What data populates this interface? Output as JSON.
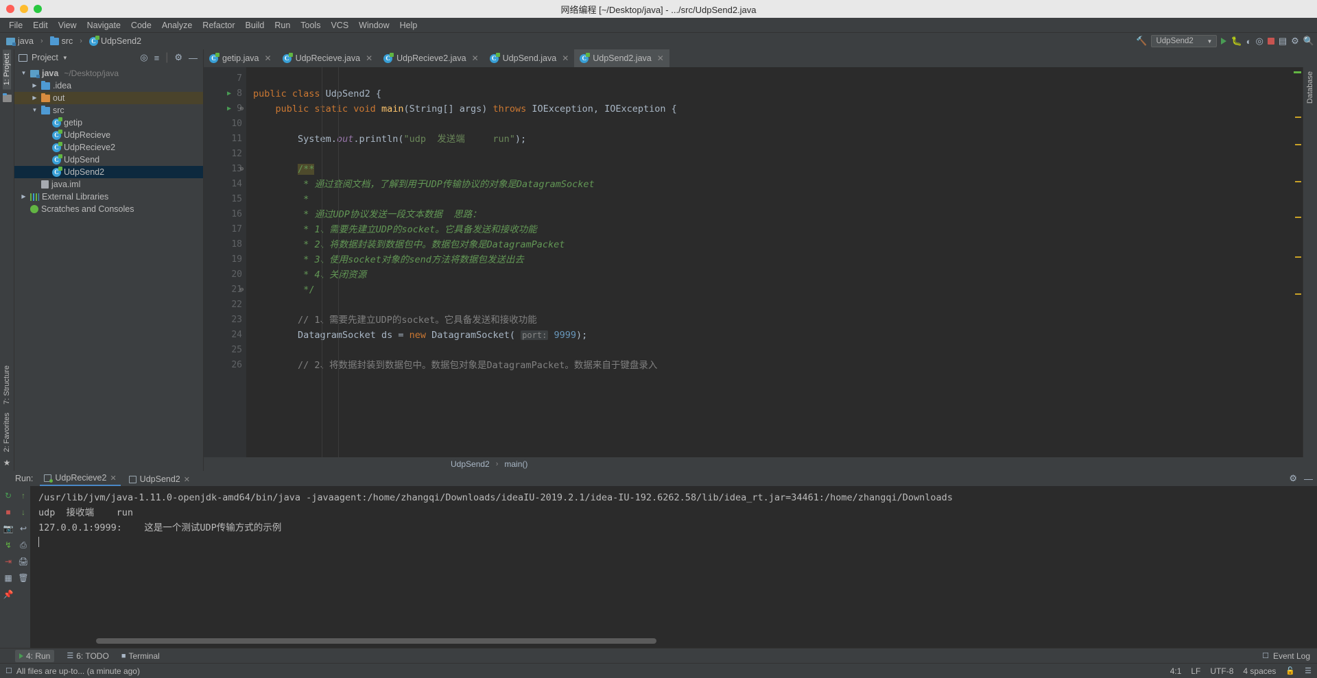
{
  "window": {
    "title": "网络编程 [~/Desktop/java] - .../src/UdpSend2.java",
    "traffic": [
      "close",
      "minimize",
      "maximize"
    ]
  },
  "menubar": {
    "items": [
      "File",
      "Edit",
      "View",
      "Navigate",
      "Code",
      "Analyze",
      "Refactor",
      "Build",
      "Run",
      "Tools",
      "VCS",
      "Window",
      "Help"
    ]
  },
  "navbar": {
    "breadcrumb": [
      "java",
      "src",
      "UdpSend2"
    ],
    "separator": "›",
    "run_configuration": "UdpSend2"
  },
  "left_strip": {
    "project_label": "1: Project",
    "structure_label": "7: Structure",
    "favorites_label": "2: Favorites"
  },
  "project_panel": {
    "title": "Project",
    "tree": [
      {
        "indent": 0,
        "arrow": "▼",
        "icon": "module-icon",
        "label": "java",
        "path": "~/Desktop/java",
        "bold": true,
        "state": ""
      },
      {
        "indent": 1,
        "arrow": "▶",
        "icon": "folder-icon",
        "label": ".idea",
        "path": "",
        "bold": false,
        "state": ""
      },
      {
        "indent": 1,
        "arrow": "▶",
        "icon": "folder-orange-icon",
        "label": "out",
        "path": "",
        "bold": false,
        "state": "out"
      },
      {
        "indent": 1,
        "arrow": "▼",
        "icon": "folder-icon",
        "label": "src",
        "path": "",
        "bold": false,
        "state": ""
      },
      {
        "indent": 2,
        "arrow": "",
        "icon": "class-icon",
        "label": "getip",
        "path": "",
        "bold": false,
        "state": ""
      },
      {
        "indent": 2,
        "arrow": "",
        "icon": "class-icon",
        "label": "UdpRecieve",
        "path": "",
        "bold": false,
        "state": ""
      },
      {
        "indent": 2,
        "arrow": "",
        "icon": "class-icon",
        "label": "UdpRecieve2",
        "path": "",
        "bold": false,
        "state": ""
      },
      {
        "indent": 2,
        "arrow": "",
        "icon": "class-icon",
        "label": "UdpSend",
        "path": "",
        "bold": false,
        "state": ""
      },
      {
        "indent": 2,
        "arrow": "",
        "icon": "class-icon",
        "label": "UdpSend2",
        "path": "",
        "bold": false,
        "state": "selected"
      },
      {
        "indent": 1,
        "arrow": "",
        "icon": "iml-icon",
        "label": "java.iml",
        "path": "",
        "bold": false,
        "state": ""
      },
      {
        "indent": 0,
        "arrow": "▶",
        "icon": "libraries-icon",
        "label": "External Libraries",
        "path": "",
        "bold": false,
        "state": ""
      },
      {
        "indent": 0,
        "arrow": "",
        "icon": "scratches-icon",
        "label": "Scratches and Consoles",
        "path": "",
        "bold": false,
        "state": ""
      }
    ]
  },
  "editor": {
    "tabs": [
      {
        "label": "getip.java",
        "active": false
      },
      {
        "label": "UdpRecieve.java",
        "active": false
      },
      {
        "label": "UdpRecieve2.java",
        "active": false
      },
      {
        "label": "UdpSend.java",
        "active": false
      },
      {
        "label": "UdpSend2.java",
        "active": true
      }
    ],
    "first_line": 7,
    "lines": [
      {
        "n": 7,
        "run": false,
        "fold": "",
        "html": ""
      },
      {
        "n": 8,
        "run": true,
        "fold": "",
        "html": "<span class=\"k\">public class </span><span class=\"id\">UdpSend2 {</span>"
      },
      {
        "n": 9,
        "run": true,
        "fold": "⊖",
        "html": "    <span class=\"k\">public static void </span><span class=\"fn\">main</span><span class=\"id\">(String[] args) </span><span class=\"k\">throws </span><span class=\"id\">IOException, IOException {</span>"
      },
      {
        "n": 10,
        "run": false,
        "fold": "",
        "html": ""
      },
      {
        "n": 11,
        "run": false,
        "fold": "",
        "html": "        <span class=\"id\">System.</span><span class=\"fld\">out</span><span class=\"id\">.println(</span><span class=\"st\">\"udp  发送端     run\"</span><span class=\"id\">);</span>"
      },
      {
        "n": 12,
        "run": false,
        "fold": "",
        "html": ""
      },
      {
        "n": 13,
        "run": false,
        "fold": "⊖",
        "html": "        <span class=\"jdm hl\">/**</span>"
      },
      {
        "n": 14,
        "run": false,
        "fold": "",
        "html": "         <span class=\"jdm\">*</span> <span class=\"jd\">通过查阅文档，了解到用于UDP传输协议的对象是DatagramSocket</span>"
      },
      {
        "n": 15,
        "run": false,
        "fold": "",
        "html": "         <span class=\"jdm\">*</span>"
      },
      {
        "n": 16,
        "run": false,
        "fold": "",
        "html": "         <span class=\"jdm\">*</span> <span class=\"jd\">通过UDP协议发送一段文本数据  思路：</span>"
      },
      {
        "n": 17,
        "run": false,
        "fold": "",
        "html": "         <span class=\"jdm\">*</span> <span class=\"jd\">1、需要先建立UDP的socket。它具备发送和接收功能</span>"
      },
      {
        "n": 18,
        "run": false,
        "fold": "",
        "html": "         <span class=\"jdm\">*</span> <span class=\"jd\">2、将数据封装到数据包中。数据包对象是DatagramPacket</span>"
      },
      {
        "n": 19,
        "run": false,
        "fold": "",
        "html": "         <span class=\"jdm\">*</span> <span class=\"jd\">3、使用socket对象的send方法将数据包发送出去</span>"
      },
      {
        "n": 20,
        "run": false,
        "fold": "",
        "html": "         <span class=\"jdm\">*</span> <span class=\"jd\">4、关闭资源</span>"
      },
      {
        "n": 21,
        "run": false,
        "fold": "⊖",
        "html": "         <span class=\"jdm\">*/</span>"
      },
      {
        "n": 22,
        "run": false,
        "fold": "",
        "html": ""
      },
      {
        "n": 23,
        "run": false,
        "fold": "",
        "html": "        <span class=\"cm\">// 1、需要先建立UDP的socket。它具备发送和接收功能</span>"
      },
      {
        "n": 24,
        "run": false,
        "fold": "",
        "html": "        <span class=\"id\">DatagramSocket ds = </span><span class=\"k\">new </span><span class=\"id\">DatagramSocket(</span> <span class=\"hint\">port:</span> <span class=\"num\">9999</span><span class=\"id\">);</span>"
      },
      {
        "n": 25,
        "run": false,
        "fold": "",
        "html": ""
      },
      {
        "n": 26,
        "run": false,
        "fold": "",
        "html": "        <span class=\"cm\">// 2、将数据封装到数据包中。数据包对象是DatagramPacket。数据来自于键盘录入</span>"
      }
    ],
    "status_breadcrumb": [
      "UdpSend2",
      "main()"
    ],
    "status_breadcrumb_sep": "›"
  },
  "run_panel": {
    "label": "Run:",
    "tabs": [
      {
        "label": "UdpRecieve2",
        "active": true,
        "running": true
      },
      {
        "label": "UdpSend2",
        "active": false,
        "running": false
      }
    ],
    "console_lines": [
      "/usr/lib/jvm/java-1.11.0-openjdk-amd64/bin/java -javaagent:/home/zhangqi/Downloads/ideaIU-2019.2.1/idea-IU-192.6262.58/lib/idea_rt.jar=34461:/home/zhangqi/Downloads",
      "udp  接收端    run",
      "127.0.0.1:9999:    这是一个测试UDP传输方式的示例"
    ]
  },
  "bottom_bar": {
    "items": [
      {
        "label": "4: Run",
        "icon": "run-icon",
        "active": true
      },
      {
        "label": "6: TODO",
        "icon": "todo-icon",
        "active": false
      },
      {
        "label": "Terminal",
        "icon": "terminal-icon",
        "active": false
      }
    ],
    "event_log": "Event Log"
  },
  "status_bar": {
    "message": "All files are up-to... (a minute ago)",
    "caret_position": "4:1",
    "line_separator": "LF",
    "encoding": "UTF-8",
    "indent": "4 spaces"
  },
  "colors": {
    "accent": "#4a88c7",
    "editor_bg": "#2b2b2b",
    "panel_bg": "#3c3f41",
    "gutter_bg": "#313335",
    "selection": "#0d293e",
    "comment_green": "#629755",
    "keyword_orange": "#cc7832",
    "string_green": "#6a8759",
    "number_blue": "#6897bb",
    "run_green": "#499c54",
    "stop_red": "#c75450"
  }
}
